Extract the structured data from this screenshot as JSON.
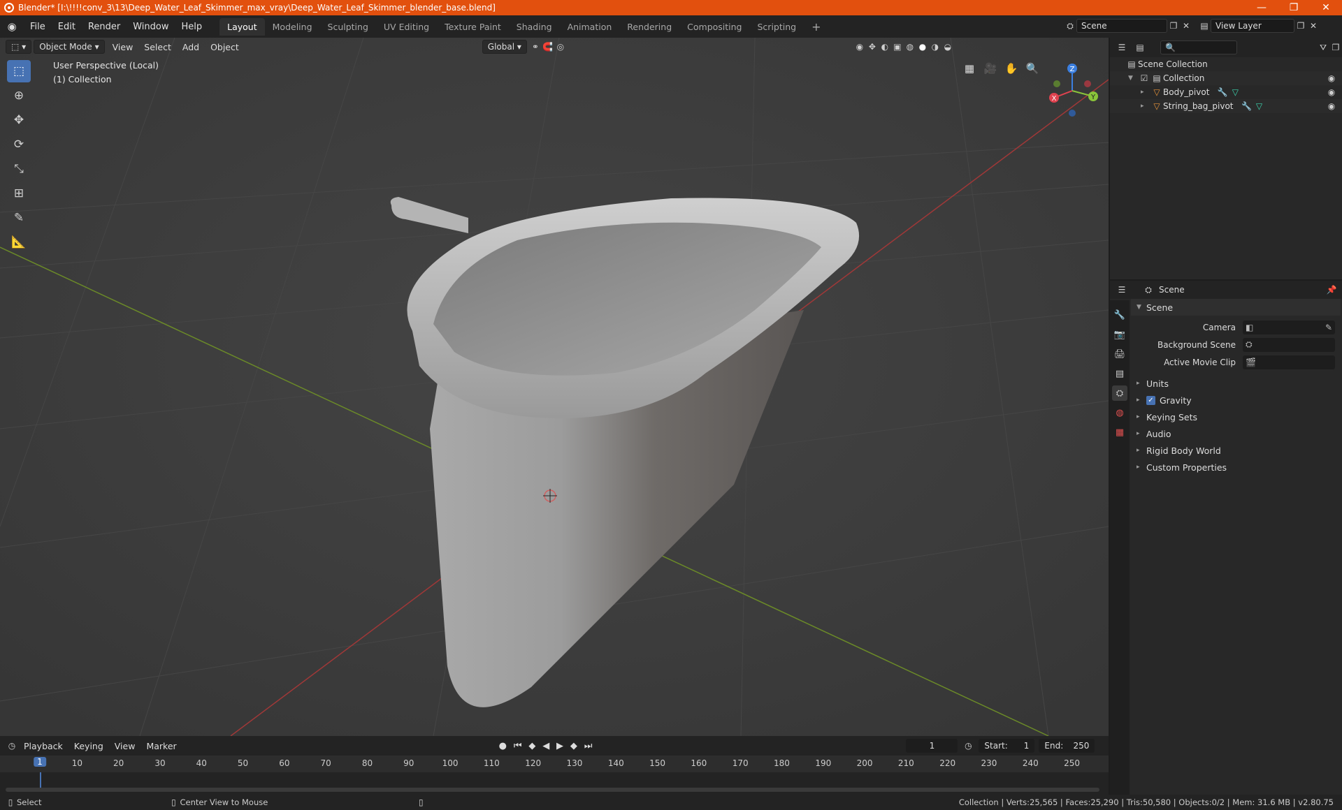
{
  "window": {
    "title": "Blender* [I:\\!!!!conv_3\\13\\Deep_Water_Leaf_Skimmer_max_vray\\Deep_Water_Leaf_Skimmer_blender_base.blend]",
    "minimize": "—",
    "restore": "❐",
    "close": "✕"
  },
  "menu": [
    "File",
    "Edit",
    "Render",
    "Window",
    "Help"
  ],
  "workspaces": [
    "Layout",
    "Modeling",
    "Sculpting",
    "UV Editing",
    "Texture Paint",
    "Shading",
    "Animation",
    "Rendering",
    "Compositing",
    "Scripting"
  ],
  "scene": {
    "name": "Scene",
    "view_layer": "View Layer"
  },
  "viewport": {
    "mode": "Object Mode",
    "menus": [
      "View",
      "Select",
      "Add",
      "Object"
    ],
    "transform": "Global",
    "info_line1": "User Perspective (Local)",
    "info_line2": "(1) Collection"
  },
  "axes": {
    "x": "X",
    "y": "Y",
    "z": "Z",
    "x_color": "#e0424f",
    "y_color": "#8ac43a",
    "z_color": "#3b7fe0"
  },
  "outliner": {
    "root": "Scene Collection",
    "collection": "Collection",
    "objects": [
      "Body_pivot",
      "String_bag_pivot"
    ]
  },
  "properties": {
    "context": "Scene",
    "panel": "Scene",
    "camera_label": "Camera",
    "background_label": "Background Scene",
    "clip_label": "Active Movie Clip",
    "subpanels": [
      "Units",
      "Gravity",
      "Keying Sets",
      "Audio",
      "Rigid Body World",
      "Custom Properties"
    ]
  },
  "timeline": {
    "menus": [
      "Playback",
      "Keying",
      "View",
      "Marker"
    ],
    "current": "1",
    "start_label": "Start:",
    "start": "1",
    "end_label": "End:",
    "end": "250",
    "ticks": [
      "10",
      "20",
      "30",
      "40",
      "50",
      "60",
      "70",
      "80",
      "90",
      "100",
      "110",
      "120",
      "130",
      "140",
      "150",
      "160",
      "170",
      "180",
      "190",
      "200",
      "210",
      "220",
      "230",
      "240",
      "250"
    ],
    "cursor": "1"
  },
  "status": {
    "left": "Select",
    "middle": "Center View to Mouse",
    "right": "Collection | Verts:25,565 | Faces:25,290 | Tris:50,580 | Objects:0/2 | Mem: 31.6 MB | v2.80.75"
  },
  "colors": {
    "accent": "#4772b3",
    "titlebar": "#e2500e"
  }
}
